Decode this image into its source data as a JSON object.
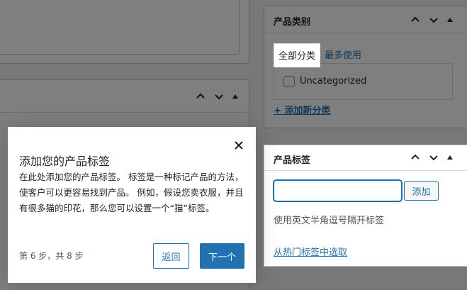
{
  "category_box": {
    "title": "产品类别",
    "tabs": [
      "全部分类",
      "最多使用"
    ],
    "items": [
      {
        "label": "Uncategorized",
        "checked": false
      }
    ],
    "add_new_label": "+ 添加新分类"
  },
  "tags_box": {
    "title": "产品标签",
    "input_value": "",
    "add_button_label": "添加",
    "hint": "使用英文半角逗号隔开标签",
    "popular_link": "从热门标签中选取"
  },
  "tour": {
    "title": "添加您的产品标签",
    "description": "在此处添加您的产品标签。 标签是一种标记产品的方法，使客户可以更容易找到产品。 例如，假设您卖衣服，并且有很多猫的印花，那么您可以设置一个“猫”标签。",
    "step_text": "第 6 步，共 8 步",
    "back_label": "返回",
    "next_label": "下一个"
  },
  "colors": {
    "accent": "#2271b1",
    "overlay": "rgba(0,0,0,0.5)"
  },
  "icons": [
    "chevron-up-icon",
    "chevron-down-icon",
    "toggle-triangle-icon",
    "close-icon"
  ]
}
